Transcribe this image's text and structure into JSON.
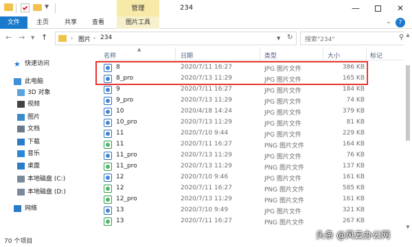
{
  "window": {
    "title": "234",
    "manage_tab": "管理"
  },
  "ribbon": {
    "tabs": [
      "文件",
      "主页",
      "共享",
      "查看",
      "图片工具"
    ]
  },
  "address": {
    "crumbs": [
      "图片",
      "234"
    ],
    "search_placeholder": "搜索\"234\""
  },
  "nav": {
    "items": [
      {
        "label": "快速访问",
        "icon": "star-icon",
        "level": "top"
      },
      {
        "label": "此电脑",
        "icon": "computer-icon",
        "level": "top"
      },
      {
        "label": "3D 对象",
        "icon": "cube-icon",
        "level": "sub"
      },
      {
        "label": "视频",
        "icon": "video-icon",
        "level": "sub"
      },
      {
        "label": "图片",
        "icon": "picture-icon",
        "level": "sub"
      },
      {
        "label": "文档",
        "icon": "document-icon",
        "level": "sub"
      },
      {
        "label": "下载",
        "icon": "download-icon",
        "level": "sub"
      },
      {
        "label": "音乐",
        "icon": "music-icon",
        "level": "sub"
      },
      {
        "label": "桌面",
        "icon": "desktop-icon",
        "level": "sub"
      },
      {
        "label": "本地磁盘 (C:)",
        "icon": "drive-icon",
        "level": "sub"
      },
      {
        "label": "本地磁盘 (D:)",
        "icon": "drive-icon",
        "level": "sub"
      },
      {
        "label": "网络",
        "icon": "network-icon",
        "level": "top"
      }
    ]
  },
  "list": {
    "columns": [
      "名称",
      "日期",
      "类型",
      "大小",
      "标记"
    ],
    "rows": [
      {
        "name": "8",
        "date": "2020/7/11 16:27",
        "type": "JPG 图片文件",
        "size": "386 KB",
        "kind": "jpg"
      },
      {
        "name": "8_pro",
        "date": "2020/7/13 11:29",
        "type": "JPG 图片文件",
        "size": "165 KB",
        "kind": "jpg"
      },
      {
        "name": "9",
        "date": "2020/7/11 16:27",
        "type": "JPG 图片文件",
        "size": "184 KB",
        "kind": "jpg"
      },
      {
        "name": "9_pro",
        "date": "2020/7/13 11:29",
        "type": "JPG 图片文件",
        "size": "74 KB",
        "kind": "jpg"
      },
      {
        "name": "10",
        "date": "2020/4/18 14:24",
        "type": "JPG 图片文件",
        "size": "379 KB",
        "kind": "jpg"
      },
      {
        "name": "10_pro",
        "date": "2020/7/13 11:29",
        "type": "JPG 图片文件",
        "size": "81 KB",
        "kind": "jpg"
      },
      {
        "name": "11",
        "date": "2020/7/10 9:44",
        "type": "JPG 图片文件",
        "size": "229 KB",
        "kind": "jpg"
      },
      {
        "name": "11",
        "date": "2020/7/11 16:27",
        "type": "PNG 图片文件",
        "size": "164 KB",
        "kind": "png"
      },
      {
        "name": "11_pro",
        "date": "2020/7/13 11:29",
        "type": "JPG 图片文件",
        "size": "76 KB",
        "kind": "jpg"
      },
      {
        "name": "11_pro",
        "date": "2020/7/13 11:29",
        "type": "PNG 图片文件",
        "size": "137 KB",
        "kind": "png"
      },
      {
        "name": "12",
        "date": "2020/7/10 9:46",
        "type": "JPG 图片文件",
        "size": "161 KB",
        "kind": "jpg"
      },
      {
        "name": "12",
        "date": "2020/7/11 16:27",
        "type": "PNG 图片文件",
        "size": "585 KB",
        "kind": "png"
      },
      {
        "name": "12_pro",
        "date": "2020/7/13 11:29",
        "type": "PNG 图片文件",
        "size": "161 KB",
        "kind": "png"
      },
      {
        "name": "13",
        "date": "2020/7/10 9:49",
        "type": "JPG 图片文件",
        "size": "321 KB",
        "kind": "jpg"
      },
      {
        "name": "13",
        "date": "2020/7/11 16:27",
        "type": "PNG 图片文件",
        "size": "267 KB",
        "kind": "png"
      }
    ]
  },
  "status": {
    "count": "70 个项目"
  },
  "watermark": "头条 @风云办公网",
  "colors": {
    "accent": "#1979ca",
    "manage": "#f7e9a8",
    "highlight": "#e8322e"
  }
}
